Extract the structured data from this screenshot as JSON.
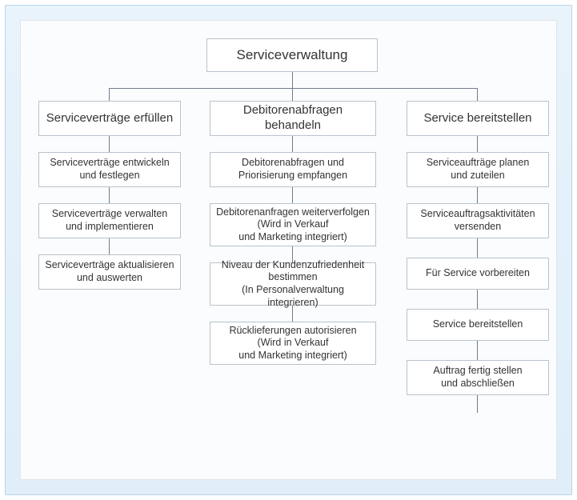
{
  "root": {
    "title": "Serviceverwaltung"
  },
  "columns": [
    {
      "head": "Serviceverträge erfüllen",
      "items": [
        "Serviceverträge entwickeln\nund festlegen",
        "Serviceverträge verwalten\nund implementieren",
        "Serviceverträge aktualisieren\nund auswerten"
      ]
    },
    {
      "head": "Debitorenabfragen behandeln",
      "items": [
        "Debitorenabfragen und\nPriorisierung empfangen",
        "Debitorenanfragen weiterverfolgen\n(Wird in Verkauf\nund Marketing integriert)",
        "Niveau der Kundenzufriedenheit\nbestimmen\n(In Personalverwaltung integrieren)",
        "Rücklieferungen autorisieren\n(Wird in Verkauf\nund Marketing integriert)"
      ]
    },
    {
      "head": "Service bereitstellen",
      "items": [
        "Serviceaufträge planen\nund zuteilen",
        "Serviceauftragsaktivitäten\nversenden",
        "Für Service vorbereiten",
        "Service bereitstellen",
        "Auftrag fertig stellen\nund abschließen"
      ]
    }
  ]
}
